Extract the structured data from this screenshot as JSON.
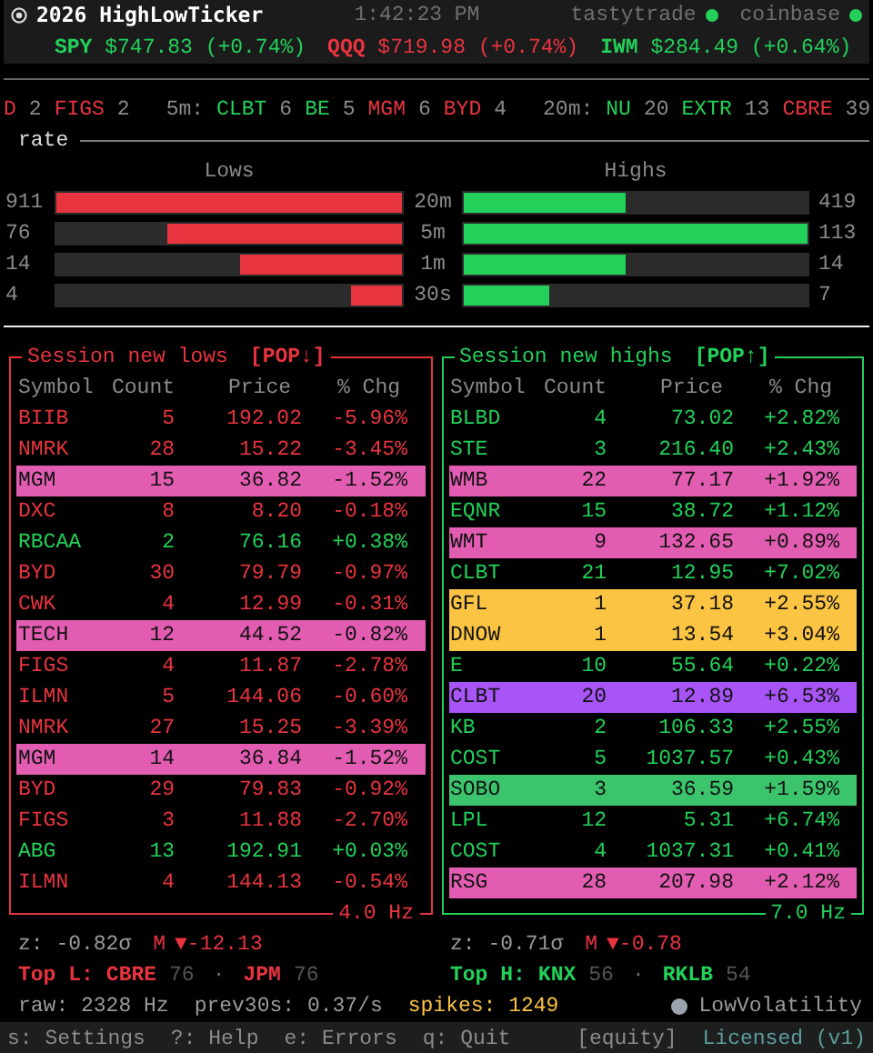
{
  "header": {
    "title": "2026 HighLowTicker",
    "time": "1:42:23 PM",
    "feeds": [
      {
        "name": "tastytrade",
        "connected": true
      },
      {
        "name": "coinbase",
        "connected": true
      }
    ]
  },
  "indices": [
    {
      "symbol": "SPY",
      "price": "$747.83",
      "change": "(+0.74%)",
      "color": "#22d05a"
    },
    {
      "symbol": "QQQ",
      "price": "$719.98",
      "change": "(+0.74%)",
      "color": "#e8343f"
    },
    {
      "symbol": "IWM",
      "price": "$284.49",
      "change": "(+0.64%)",
      "color": "#22d05a"
    }
  ],
  "strip": [
    {
      "items": [
        {
          "symbol": "D",
          "kind": "low",
          "count": "2"
        },
        {
          "symbol": "FIGS",
          "kind": "low",
          "count": "2"
        }
      ]
    },
    {
      "label": "5m:",
      "items": [
        {
          "symbol": "CLBT",
          "kind": "high",
          "count": "6"
        },
        {
          "symbol": "BE",
          "kind": "high",
          "count": "5"
        },
        {
          "symbol": "MGM",
          "kind": "low",
          "count": "6"
        },
        {
          "symbol": "BYD",
          "kind": "low",
          "count": "4"
        }
      ]
    },
    {
      "label": "20m:",
      "items": [
        {
          "symbol": "NU",
          "kind": "high",
          "count": "20"
        },
        {
          "symbol": "EXTR",
          "kind": "high",
          "count": "13"
        },
        {
          "symbol": "CBRE",
          "kind": "low",
          "count": "39"
        }
      ]
    }
  ],
  "rate": {
    "title": "rate",
    "columns": [
      "Lows",
      "Highs"
    ],
    "rows": [
      {
        "window": "20m",
        "lows": {
          "count": "911",
          "level": 1.0
        },
        "highs": {
          "count": "419",
          "level": 0.47
        }
      },
      {
        "window": "5m",
        "lows": {
          "count": "76",
          "level": 0.68
        },
        "highs": {
          "count": "113",
          "level": 1.0
        }
      },
      {
        "window": "1m",
        "lows": {
          "count": "14",
          "level": 0.47
        },
        "highs": {
          "count": "14",
          "level": 0.47
        }
      },
      {
        "window": "30s",
        "lows": {
          "count": "4",
          "level": 0.15
        },
        "highs": {
          "count": "7",
          "level": 0.25
        }
      }
    ]
  },
  "panels": [
    {
      "kind": "low",
      "title": "Session new lows",
      "tag": "[POP↓]",
      "columns": [
        "Symbol",
        "Count",
        "Price",
        "% Chg"
      ],
      "rate": "4.0 Hz",
      "rows": [
        {
          "symbol": "BIIB",
          "count": "5",
          "price": "192.02",
          "change": "-5.96%",
          "gain": false
        },
        {
          "symbol": "NMRK",
          "count": "28",
          "price": "15.22",
          "change": "-3.45%",
          "gain": false
        },
        {
          "symbol": "MGM",
          "count": "15",
          "price": "36.82",
          "change": "-1.52%",
          "color": "#e25db2"
        },
        {
          "symbol": "DXC",
          "count": "8",
          "price": "8.20",
          "change": "-0.18%",
          "gain": false
        },
        {
          "symbol": "RBCAA",
          "count": "2",
          "price": "76.16",
          "change": "+0.38%",
          "gain": true
        },
        {
          "symbol": "BYD",
          "count": "30",
          "price": "79.79",
          "change": "-0.97%",
          "gain": false
        },
        {
          "symbol": "CWK",
          "count": "4",
          "price": "12.99",
          "change": "-0.31%",
          "gain": false
        },
        {
          "symbol": "TECH",
          "count": "12",
          "price": "44.52",
          "change": "-0.82%",
          "color": "#e25db2"
        },
        {
          "symbol": "FIGS",
          "count": "4",
          "price": "11.87",
          "change": "-2.78%",
          "gain": false
        },
        {
          "symbol": "ILMN",
          "count": "5",
          "price": "144.06",
          "change": "-0.60%",
          "gain": false
        },
        {
          "symbol": "NMRK",
          "count": "27",
          "price": "15.25",
          "change": "-3.39%",
          "gain": false
        },
        {
          "symbol": "MGM",
          "count": "14",
          "price": "36.84",
          "change": "-1.52%",
          "color": "#e25db2"
        },
        {
          "symbol": "BYD",
          "count": "29",
          "price": "79.83",
          "change": "-0.92%",
          "gain": false
        },
        {
          "symbol": "FIGS",
          "count": "3",
          "price": "11.88",
          "change": "-2.70%",
          "gain": false
        },
        {
          "symbol": "ABG",
          "count": "13",
          "price": "192.91",
          "change": "+0.03%",
          "gain": true
        },
        {
          "symbol": "ILMN",
          "count": "4",
          "price": "144.13",
          "change": "-0.54%",
          "gain": false
        }
      ],
      "stats": {
        "z": "z: -0.82σ",
        "m_label": "M",
        "m_value": "▼-12.13",
        "top_label": "Top L:",
        "separator": "·",
        "tops": [
          {
            "symbol": "CBRE",
            "count": "76"
          },
          {
            "symbol": "JPM",
            "count": "76"
          }
        ]
      }
    },
    {
      "kind": "high",
      "title": "Session new highs",
      "tag": "[POP↑]",
      "columns": [
        "Symbol",
        "Count",
        "Price",
        "% Chg"
      ],
      "rate": "7.0 Hz",
      "rows": [
        {
          "symbol": "BLBD",
          "count": "4",
          "price": "73.02",
          "change": "+2.82%",
          "gain": true
        },
        {
          "symbol": "STE",
          "count": "3",
          "price": "216.40",
          "change": "+2.43%",
          "gain": true
        },
        {
          "symbol": "WMB",
          "count": "22",
          "price": "77.17",
          "change": "+1.92%",
          "color": "#e25db2"
        },
        {
          "symbol": "EQNR",
          "count": "15",
          "price": "38.72",
          "change": "+1.12%",
          "gain": true
        },
        {
          "symbol": "WMT",
          "count": "9",
          "price": "132.65",
          "change": "+0.89%",
          "color": "#e25db2"
        },
        {
          "symbol": "CLBT",
          "count": "21",
          "price": "12.95",
          "change": "+7.02%",
          "gain": true
        },
        {
          "symbol": "GFL",
          "count": "1",
          "price": "37.18",
          "change": "+2.55%",
          "color": "#fbc443"
        },
        {
          "symbol": "DNOW",
          "count": "1",
          "price": "13.54",
          "change": "+3.04%",
          "color": "#fbc443"
        },
        {
          "symbol": "E",
          "count": "10",
          "price": "55.64",
          "change": "+0.22%",
          "gain": true
        },
        {
          "symbol": "CLBT",
          "count": "20",
          "price": "12.89",
          "change": "+6.53%",
          "color": "#a855f7"
        },
        {
          "symbol": "KB",
          "count": "2",
          "price": "106.33",
          "change": "+2.55%",
          "gain": true
        },
        {
          "symbol": "COST",
          "count": "5",
          "price": "1037.57",
          "change": "+0.43%",
          "gain": true
        },
        {
          "symbol": "SOBO",
          "count": "3",
          "price": "36.59",
          "change": "+1.59%",
          "color": "#3cc46c"
        },
        {
          "symbol": "LPL",
          "count": "12",
          "price": "5.31",
          "change": "+6.74%",
          "gain": true
        },
        {
          "symbol": "COST",
          "count": "4",
          "price": "1037.31",
          "change": "+0.41%",
          "gain": true
        },
        {
          "symbol": "RSG",
          "count": "28",
          "price": "207.98",
          "change": "+2.12%",
          "color": "#e25db2"
        }
      ],
      "stats": {
        "z": "z: -0.71σ",
        "m_label": "M",
        "m_value": "▼-0.78",
        "top_label": "Top H:",
        "separator": "·",
        "tops": [
          {
            "symbol": "KNX",
            "count": "56"
          },
          {
            "symbol": "RKLB",
            "count": "54"
          }
        ]
      }
    }
  ],
  "footer": {
    "raw": "raw: 2328 Hz",
    "prev": "prev30s: 0.37/s",
    "spikes": "spikes: 1249",
    "regime": {
      "label": "LowVolatility",
      "color": "#9ca3af"
    }
  },
  "keybar": {
    "keys": [
      {
        "key": "s:",
        "label": "Settings"
      },
      {
        "key": "?:",
        "label": "Help"
      },
      {
        "key": "e:",
        "label": "Errors"
      },
      {
        "key": "q:",
        "label": "Quit"
      }
    ],
    "mode": "[equity]",
    "license": "Licensed (v1)"
  }
}
